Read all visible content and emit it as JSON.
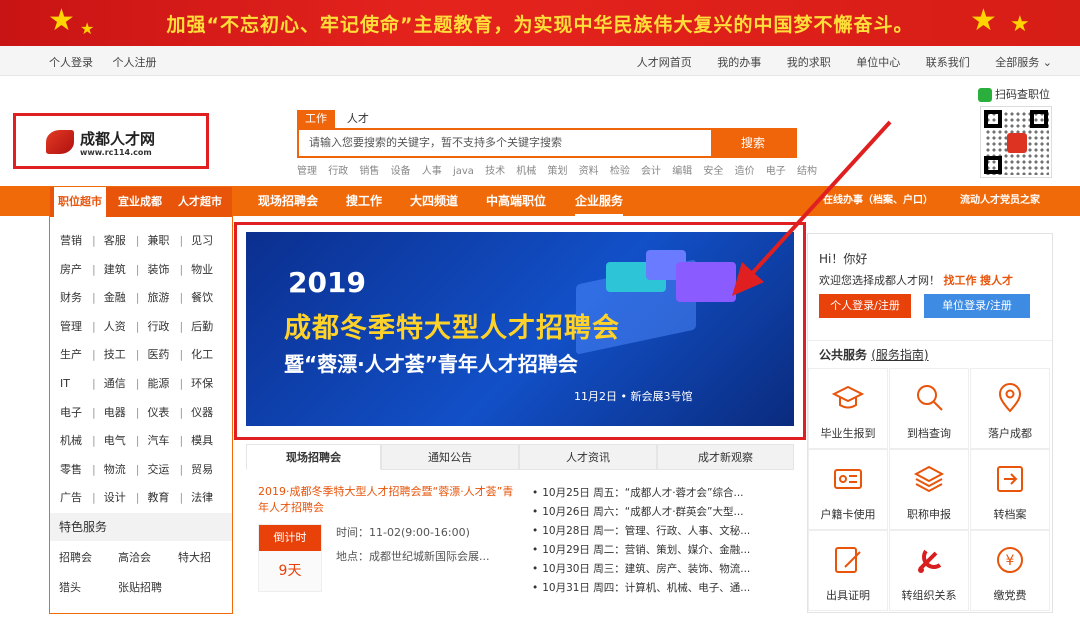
{
  "banner": {
    "slogan": "加强“不忘初心、牢记使命”主题教育，为实现中华民族伟大复兴的中国梦不懈奋斗。"
  },
  "topbar": {
    "left": [
      "个人登录",
      "个人注册"
    ],
    "right": [
      "人才网首页",
      "我的办事",
      "我的求职",
      "单位中心",
      "联系我们",
      "全部服务 ⌄"
    ]
  },
  "logo": {
    "name": "成都人才网",
    "url": "www.rc114.com"
  },
  "search": {
    "tabs": [
      "工作",
      "人才"
    ],
    "placeholder": "请输入您要搜索的关键字，暂不支持多个关键字搜索",
    "button": "搜索",
    "hot": [
      "管理",
      "行政",
      "销售",
      "设备",
      "人事",
      "java",
      "技术",
      "机械",
      "策划",
      "资料",
      "检验",
      "会计",
      "编辑",
      "安全",
      "造价",
      "电子",
      "结构"
    ]
  },
  "qr": {
    "label": "扫码查职位"
  },
  "nav": {
    "items": [
      "现场招聘会",
      "搜工作",
      "大四频道",
      "中高端职位",
      "企业服务"
    ],
    "right": [
      "在线办事（档案、户口）",
      "流动人才党员之家"
    ]
  },
  "sidebar": {
    "tabs": [
      "职位超市",
      "宜业成都",
      "人才超市"
    ],
    "rows": [
      [
        "营销",
        "客服",
        "兼职",
        "见习"
      ],
      [
        "房产",
        "建筑",
        "装饰",
        "物业"
      ],
      [
        "财务",
        "金融",
        "旅游",
        "餐饮"
      ],
      [
        "管理",
        "人资",
        "行政",
        "后勤"
      ],
      [
        "生产",
        "技工",
        "医药",
        "化工"
      ],
      [
        "IT",
        "通信",
        "能源",
        "环保"
      ],
      [
        "电子",
        "电器",
        "仪表",
        "仪器"
      ],
      [
        "机械",
        "电气",
        "汽车",
        "模具"
      ],
      [
        "零售",
        "物流",
        "交运",
        "贸易"
      ],
      [
        "广告",
        "设计",
        "教育",
        "法律"
      ]
    ],
    "feature_title": "特色服务",
    "features": [
      "招聘会",
      "高洽会",
      "特大招",
      "猎头",
      "张贴招聘"
    ]
  },
  "hero": {
    "year": "2019",
    "title": "成都冬季特大型人才招聘会",
    "subtitle": "暨“蓉漂·人才荟”青年人才招聘会",
    "date": "11月2日 • 新会展3号馆"
  },
  "tabs": [
    "现场招聘会",
    "通知公告",
    "人才资讯",
    "成才新观察"
  ],
  "fair": {
    "link": "2019·成都冬季特大型人才招聘会暨“蓉漂·人才荟”青年人才招聘会",
    "countdown_label": "倒计时",
    "countdown_value": "9天",
    "time": "时间：11-02(9:00-16:00)",
    "place": "地点：成都世纪城新国际会展..."
  },
  "news": [
    "10月25日 周五：“成都人才·蓉才会”综合...",
    "10月26日 周六：“成都人才·群英会”大型...",
    "10月28日 周一：管理、行政、人事、文秘...",
    "10月29日 周二：营销、策划、媒介、金融...",
    "10月30日 周三：建筑、房产、装饰、物流...",
    "10月31日 周四：计算机、机械、电子、通..."
  ],
  "account": {
    "hi": "Hi！你好",
    "welcome": "欢迎您选择成都人才网！",
    "find_job": "找工作",
    "find_talent": "搜人才",
    "personal_btn": "个人登录/注册",
    "company_btn": "单位登录/注册"
  },
  "services": {
    "title": "公共服务",
    "guide": "(服务指南)",
    "items": [
      {
        "label": "毕业生报到",
        "icon": "graduation-cap-icon"
      },
      {
        "label": "到档查询",
        "icon": "magnifier-icon"
      },
      {
        "label": "落户成都",
        "icon": "location-pin-icon"
      },
      {
        "label": "户籍卡使用",
        "icon": "id-card-icon"
      },
      {
        "label": "职称申报",
        "icon": "layers-icon"
      },
      {
        "label": "转档案",
        "icon": "file-transfer-icon"
      },
      {
        "label": "出具证明",
        "icon": "edit-document-icon"
      },
      {
        "label": "转组织关系",
        "icon": "party-emblem-icon"
      },
      {
        "label": "缴党费",
        "icon": "yuan-coin-icon"
      }
    ]
  },
  "colors": {
    "accent": "#f06a0a",
    "red": "#e02020",
    "blue": "#3d8be3"
  }
}
